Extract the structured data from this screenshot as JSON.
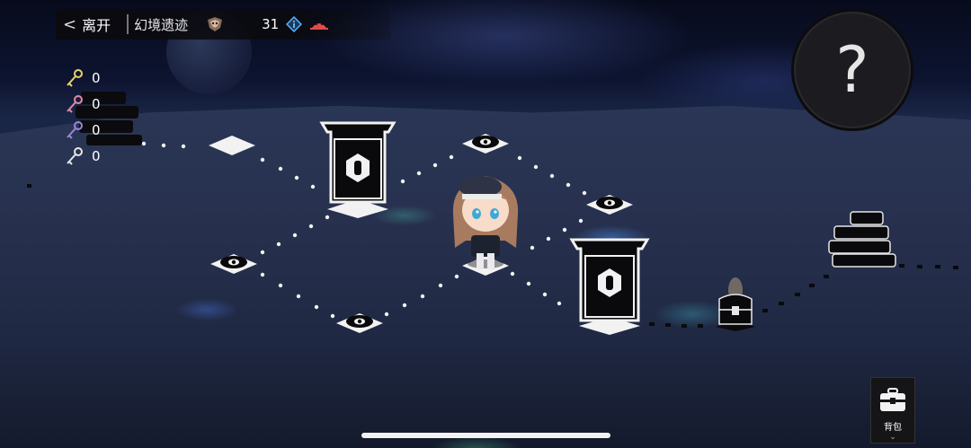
{
  "header": {
    "back_label": "离开",
    "area_name": "幻境遗迹",
    "currency_count": "31"
  },
  "keys": [
    {
      "icon": "gold-key-icon",
      "color": "#e8d36a",
      "count": "0"
    },
    {
      "icon": "pink-key-icon",
      "color": "#e08aa6",
      "count": "0"
    },
    {
      "icon": "purple-key-icon",
      "color": "#9b86d8",
      "count": "0"
    },
    {
      "icon": "white-key-icon",
      "color": "#e6e6e6",
      "count": "0"
    }
  ],
  "help": {
    "symbol": "?"
  },
  "bag": {
    "label": "背包",
    "chevron": "⌄"
  },
  "colors": {
    "tile": "#f2f2f2",
    "icon": "#000000",
    "accent_blue": "#5ab3ff",
    "accent_red": "#e24a4a"
  }
}
